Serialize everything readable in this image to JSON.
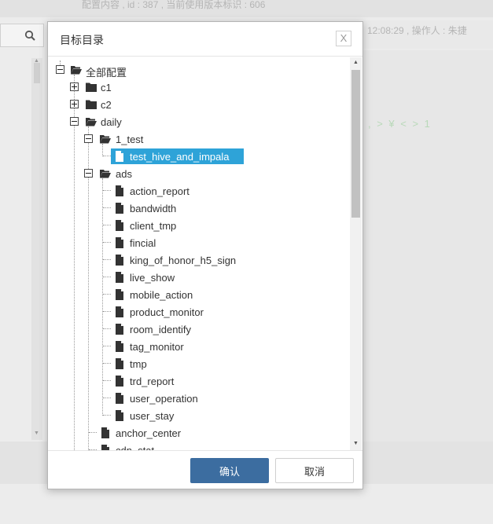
{
  "background": {
    "top_text": "配置内容 , id : 387 , 当前使用版本标识 : 606",
    "right_header_text": "12:08:29 , 操作人 : 朱捷",
    "green_text": ", > ¥ < > 1"
  },
  "dialog": {
    "title": "目标目录",
    "close_label": "X",
    "confirm_label": "确认",
    "cancel_label": "取消"
  },
  "tree": {
    "root": "全部配置",
    "c1": "c1",
    "c2": "c2",
    "daily": "daily",
    "test_folder": "1_test",
    "selected_file": "test_hive_and_impala",
    "ads": "ads",
    "ads_files": [
      "action_report",
      "bandwidth",
      "client_tmp",
      "fincial",
      "king_of_honor_h5_sign",
      "live_show",
      "mobile_action",
      "product_monitor",
      "room_identify",
      "tag_monitor",
      "tmp",
      "trd_report",
      "user_operation",
      "user_stay"
    ],
    "anchor_center": "anchor_center",
    "cdn_stat": "cdn_stat"
  },
  "colors": {
    "selected": "#2ea3d8",
    "primary_button": "#3c6da0"
  }
}
